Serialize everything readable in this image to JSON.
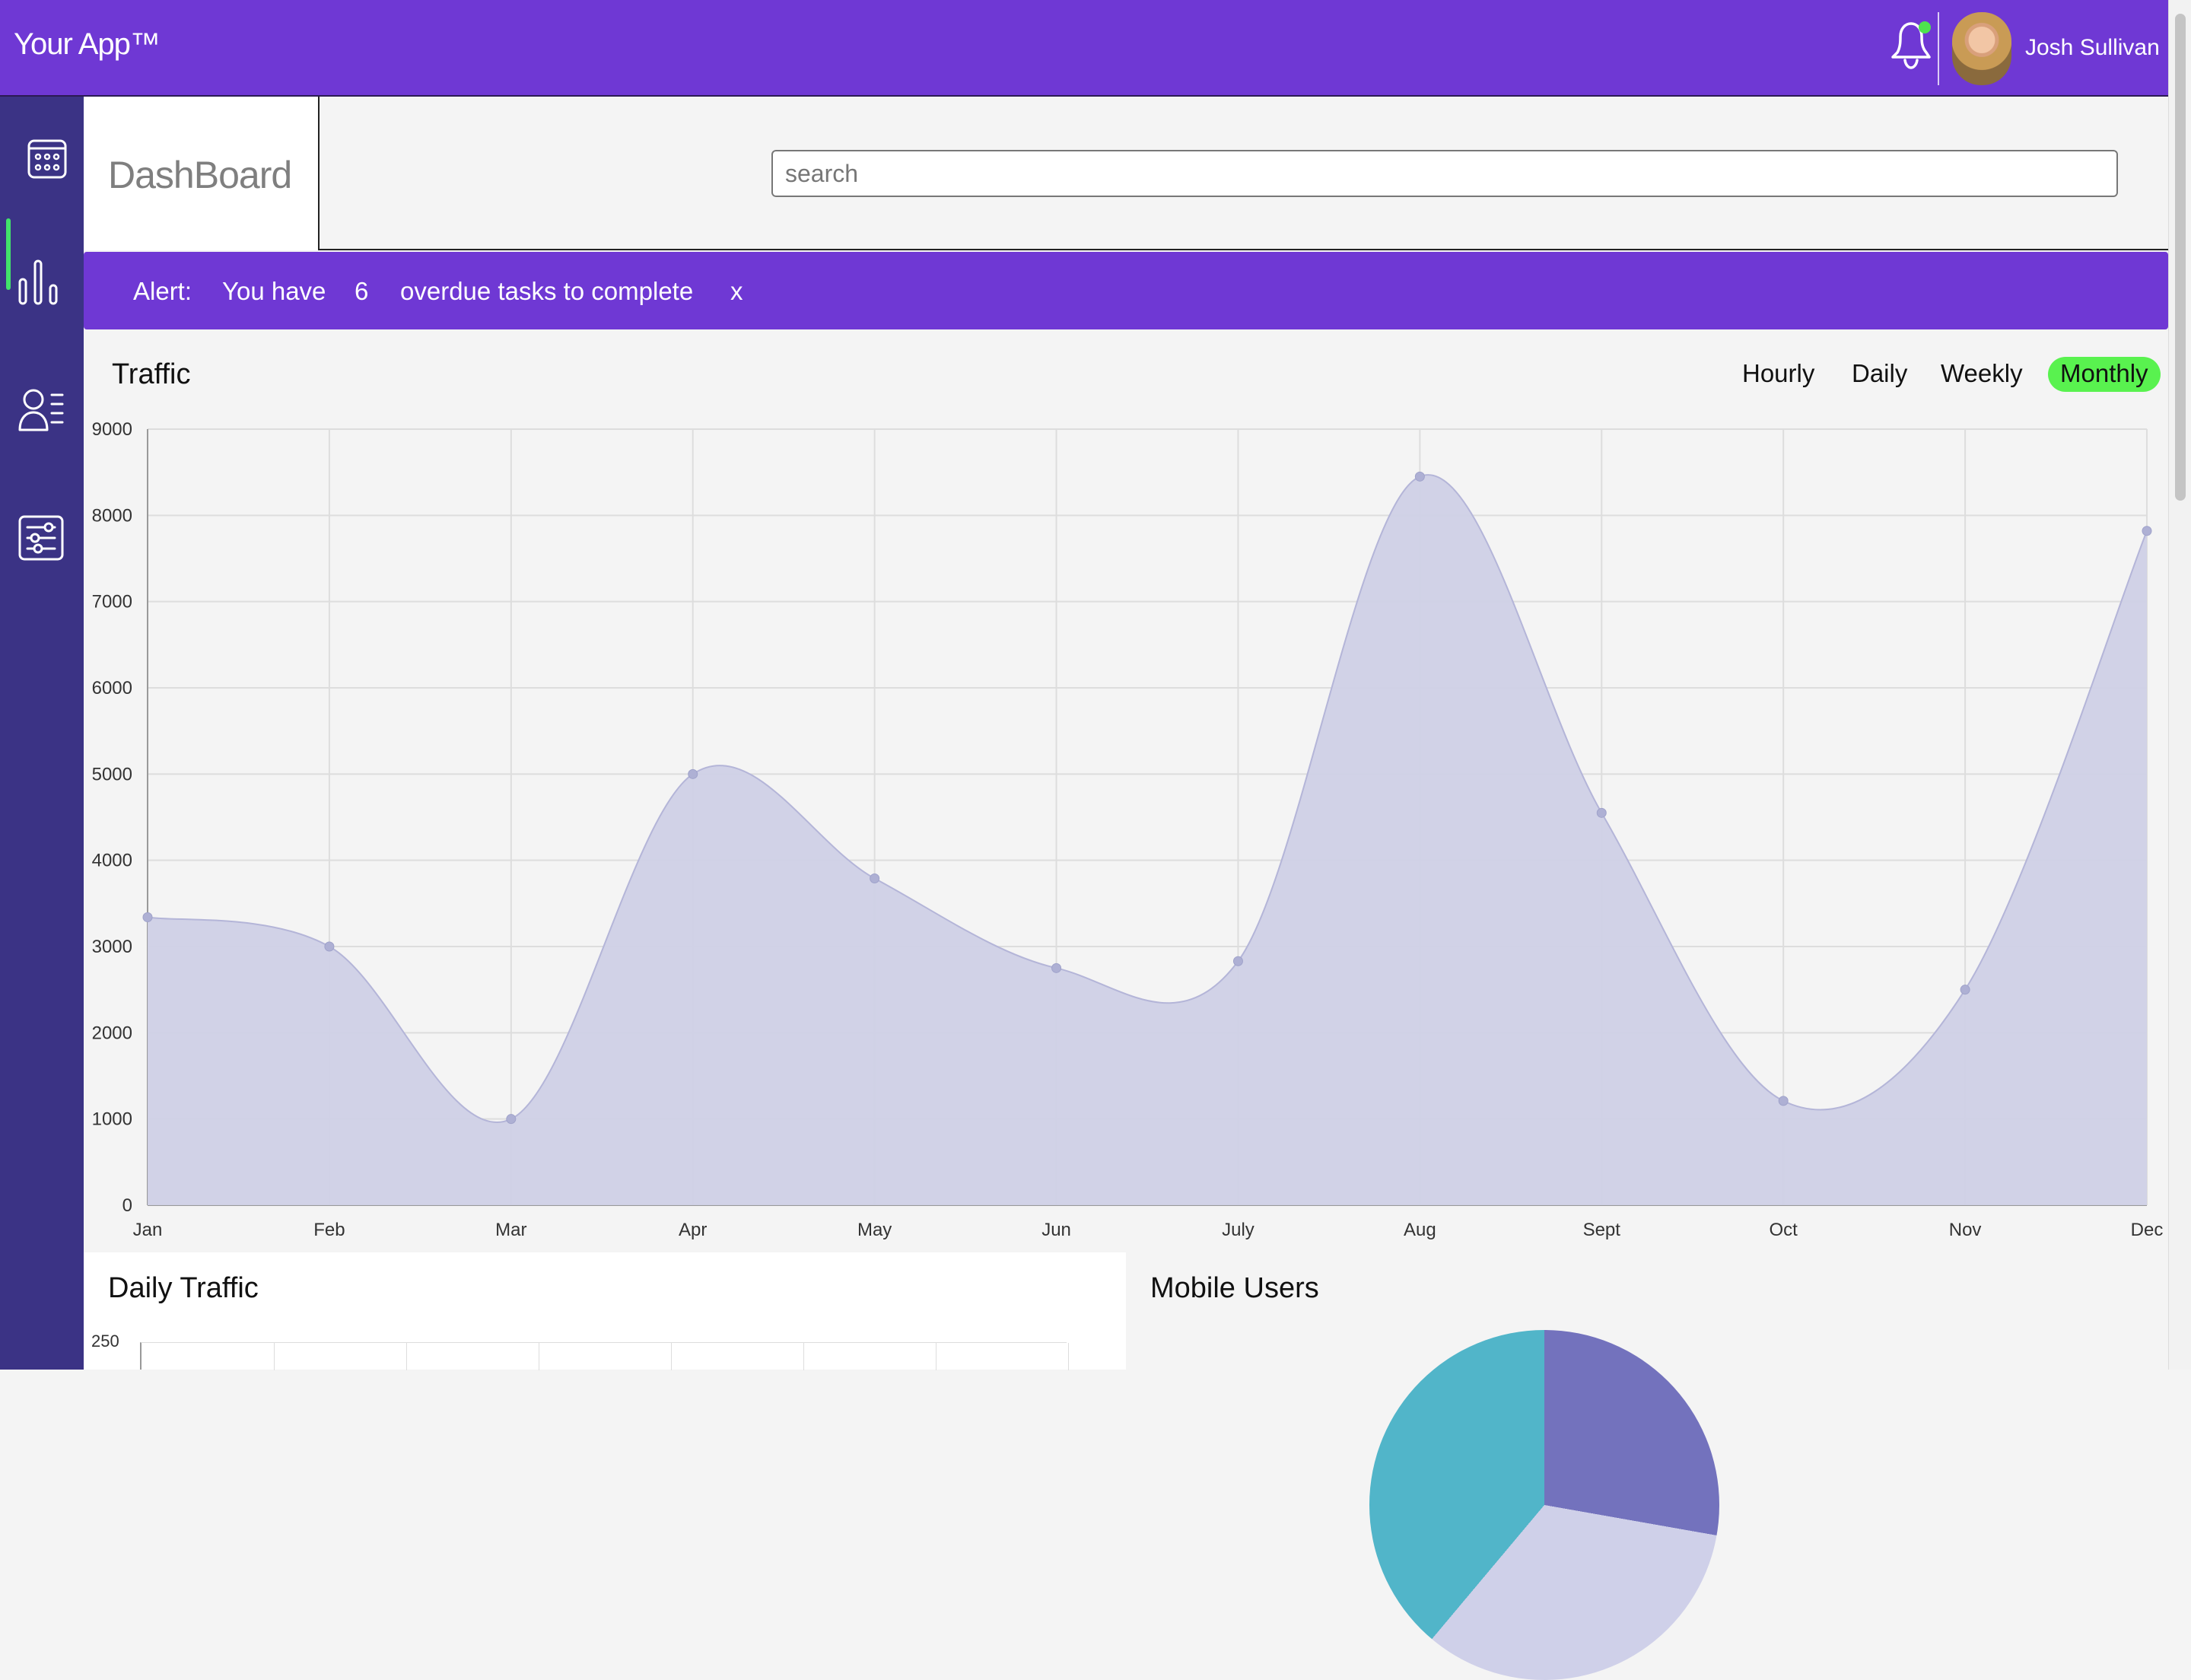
{
  "app": {
    "brand": "Your App™",
    "user_name": "Josh Sullivan",
    "notification_indicator": "green",
    "search_placeholder": "search"
  },
  "page": {
    "title": "DashBoard"
  },
  "alert": {
    "label": "Alert:",
    "prefix": "You have",
    "count": "6",
    "suffix": "overdue tasks to complete",
    "dismiss": "x"
  },
  "sidebar": {
    "items": [
      {
        "name": "calendar-icon",
        "active": true
      },
      {
        "name": "analytics-icon",
        "active": false
      },
      {
        "name": "members-icon",
        "active": false
      },
      {
        "name": "settings-icon",
        "active": false
      }
    ]
  },
  "traffic": {
    "title": "Traffic",
    "ranges": [
      "Hourly",
      "Daily",
      "Weekly",
      "Monthly"
    ],
    "active_range": "Monthly"
  },
  "chart_data": {
    "type": "area",
    "title": "Traffic",
    "categories": [
      "Jan",
      "Feb",
      "Mar",
      "Apr",
      "May",
      "Jun",
      "July",
      "Aug",
      "Sept",
      "Oct",
      "Nov",
      "Dec"
    ],
    "values": [
      3340,
      3000,
      1000,
      5000,
      3790,
      2750,
      2830,
      8450,
      4550,
      1210,
      2500,
      7820
    ],
    "ylim": [
      0,
      9000
    ],
    "yticks": [
      0,
      1000,
      2000,
      3000,
      4000,
      5000,
      6000,
      7000,
      8000,
      9000
    ],
    "grid": true,
    "colors": {
      "fill": "#cfd0e6",
      "line": "#b4b5d8",
      "point": "#aeb0d4",
      "grid": "#dddddd"
    }
  },
  "panels": {
    "daily_traffic": {
      "title": "Daily Traffic",
      "y_tick_label": "250"
    },
    "mobile_users": {
      "title": "Mobile Users"
    }
  },
  "colors": {
    "header": "#6f38d4",
    "sidebar": "#3b3385",
    "accent": "#59f24f",
    "indicator": "#42e36b"
  }
}
